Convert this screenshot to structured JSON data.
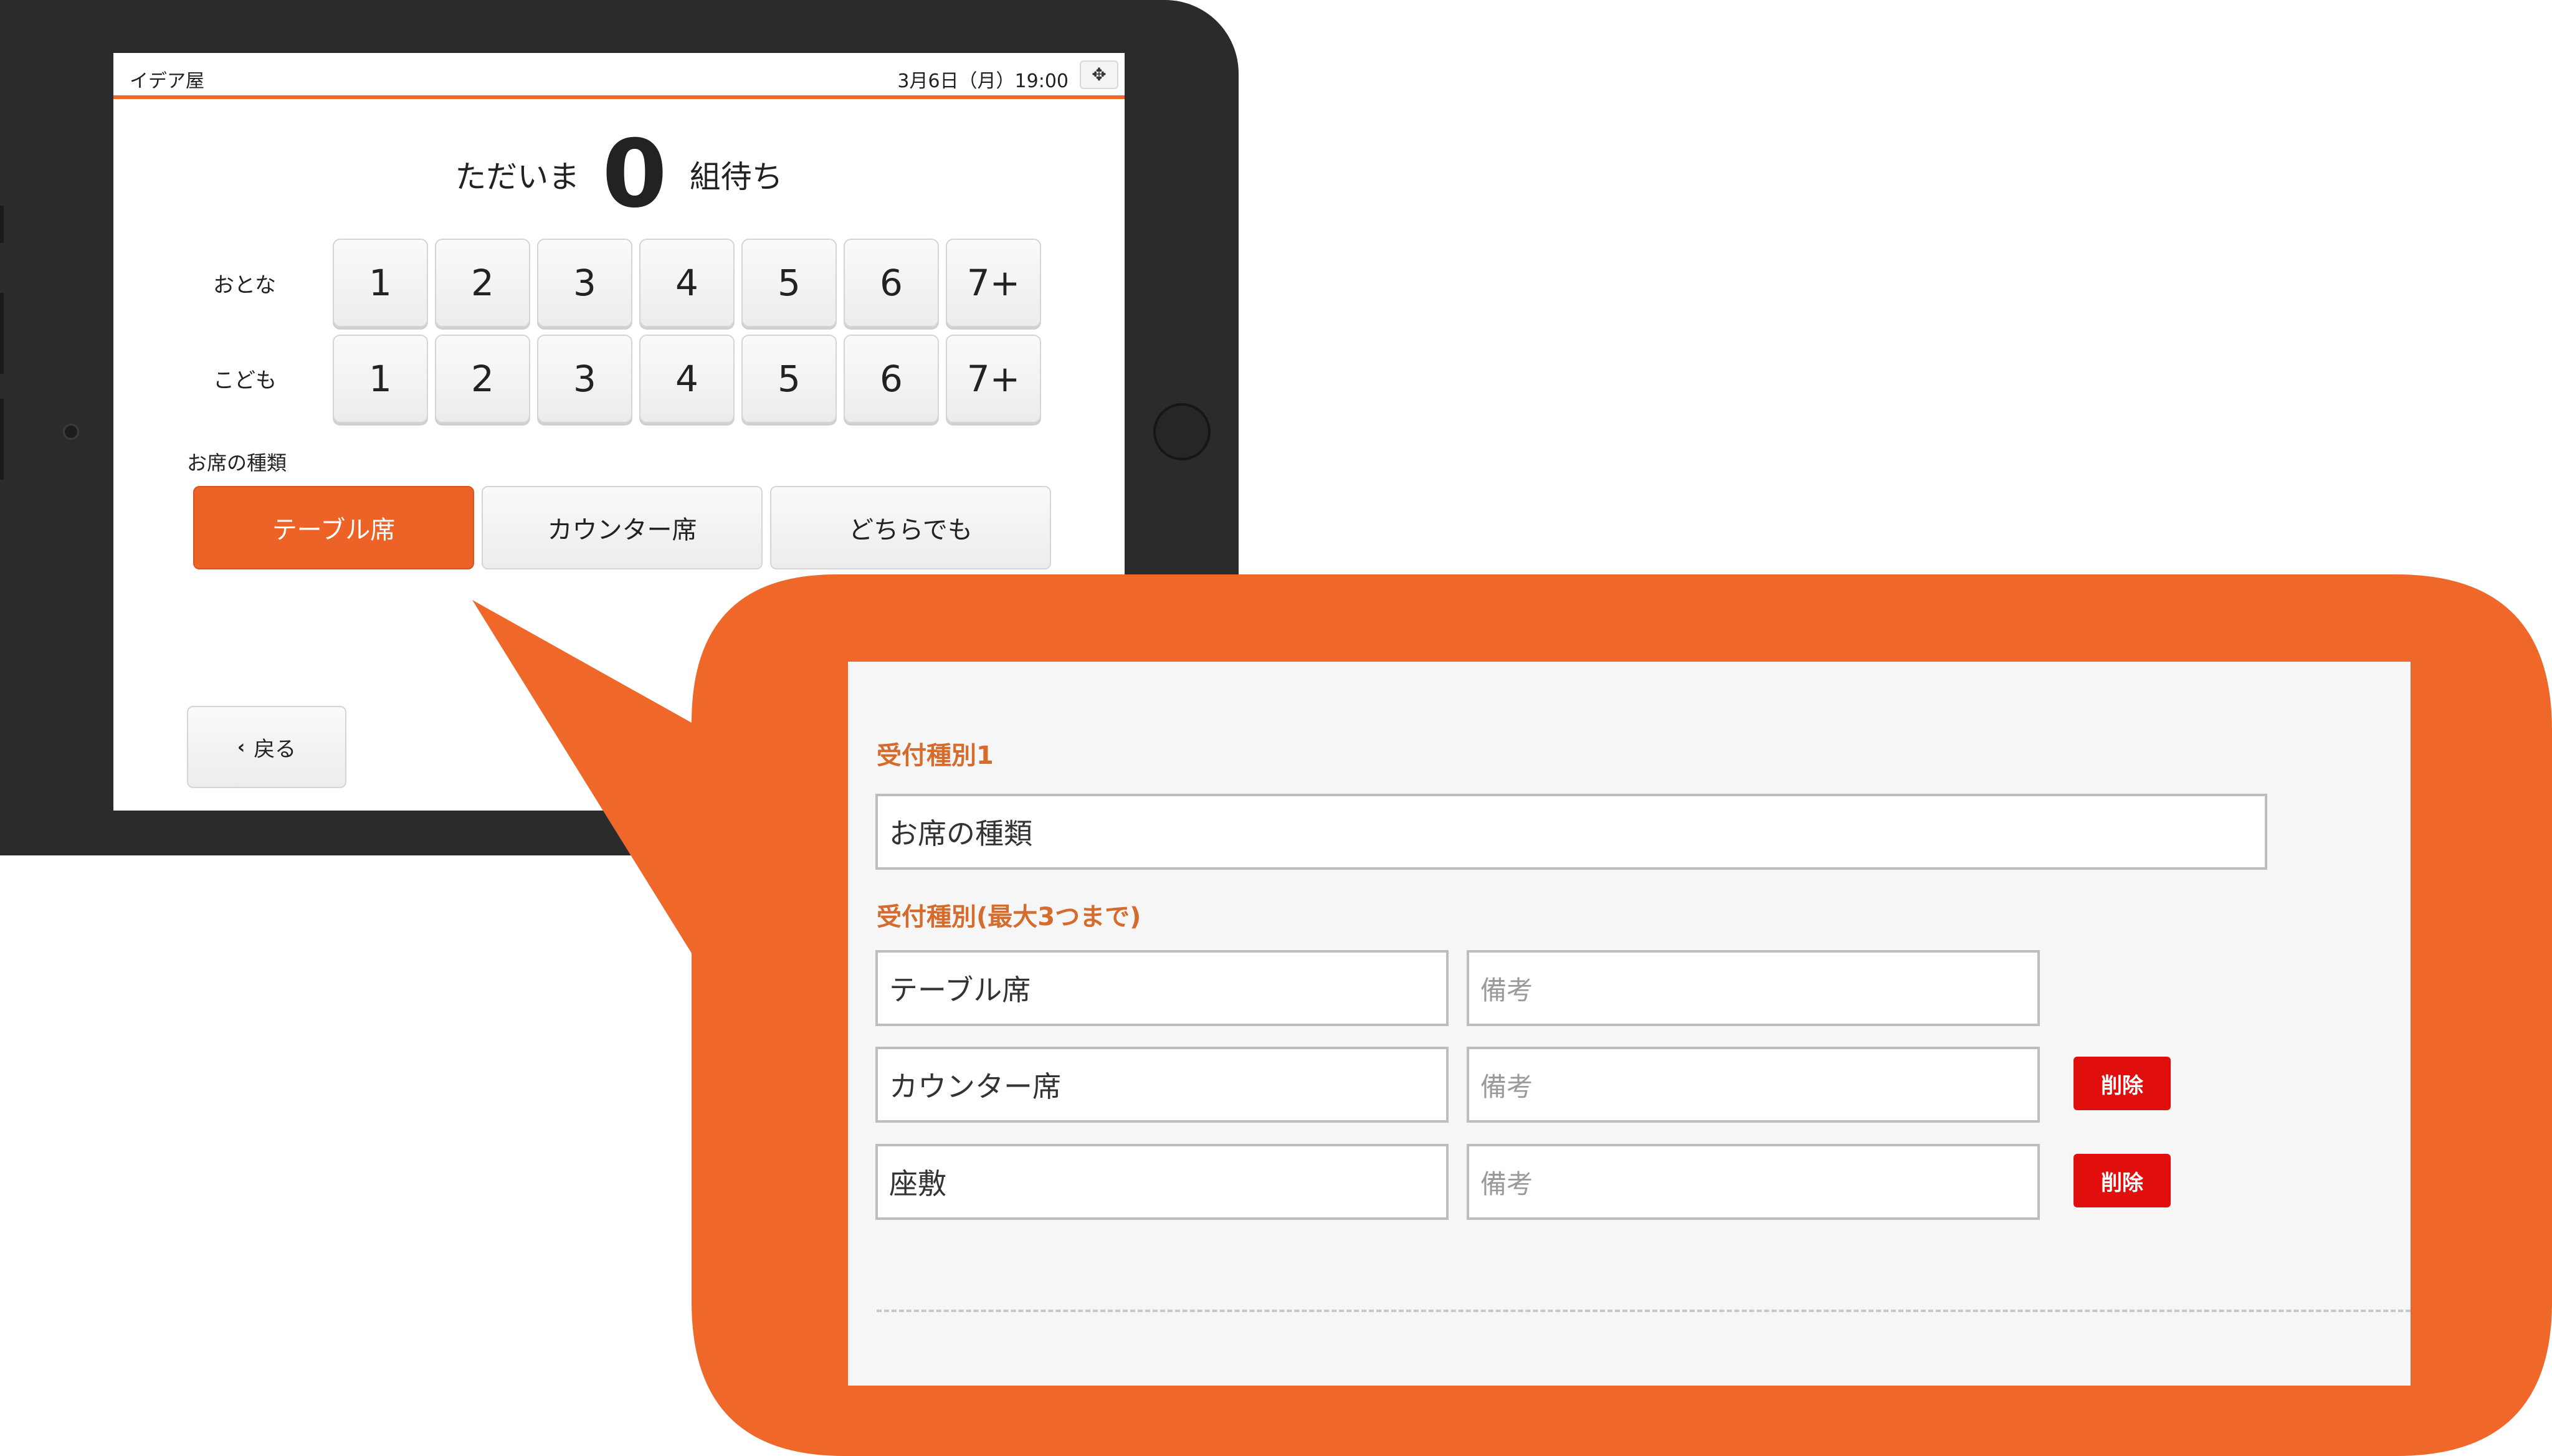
{
  "status_bar": {
    "store_name": "イデア屋",
    "datetime": "3月6日（月）19:00",
    "menu_icon": "move-icon"
  },
  "waiting": {
    "prefix": "ただいま",
    "count": "0",
    "suffix": "組待ち"
  },
  "adults": {
    "label": "おとな",
    "options": [
      "1",
      "2",
      "3",
      "4",
      "5",
      "6",
      "7+"
    ]
  },
  "children": {
    "label": "こども",
    "options": [
      "1",
      "2",
      "3",
      "4",
      "5",
      "6",
      "7+"
    ]
  },
  "seat_type": {
    "label": "お席の種類",
    "options": [
      "テーブル席",
      "カウンター席",
      "どちらでも"
    ],
    "selected": "テーブル席"
  },
  "back_button": {
    "icon": "chevron-left-icon",
    "label": "戻る"
  },
  "settings": {
    "section1_title": "受付種別1",
    "section1_value": "お席の種類",
    "section2_title": "受付種別(最大3つまで)",
    "rows": [
      {
        "name": "テーブル席",
        "note_placeholder": "備考",
        "delete_label": ""
      },
      {
        "name": "カウンター席",
        "note_placeholder": "備考",
        "delete_label": "削除"
      },
      {
        "name": "座敷",
        "note_placeholder": "備考",
        "delete_label": "削除"
      }
    ]
  },
  "colors": {
    "accent": "#ec6227",
    "bubble": "#f0672a",
    "delete": "#e10e0e",
    "section_title": "#d56b2d"
  }
}
